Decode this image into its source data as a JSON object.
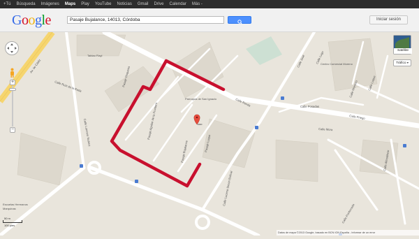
{
  "topnav": {
    "items": [
      "+Tú",
      "Búsqueda",
      "Imágenes",
      "Maps",
      "Play",
      "YouTube",
      "Noticias",
      "Gmail",
      "Drive",
      "Calendar",
      "Más -"
    ],
    "active": "Maps"
  },
  "header": {
    "logo": "Google",
    "search_value": "Pasaje Bujalance, 14013, Córdoba",
    "signin_label": "Iniciar sesión"
  },
  "map": {
    "layer_satellite": "Satélite",
    "layer_traffic": "Tráfico",
    "scale_meters": "50 m",
    "scale_feet": "100 pies",
    "copyright": "Datos de mapa ©2013 Google, basado en BCN IGN España - Informar de un error",
    "places": {
      "tablao": "Tablao Flayl",
      "parroquia": "Parroquia de San Ignacio",
      "centro": "Centro Comercial Moreno",
      "escuela": "Escuelas Hermanos",
      "marquinas": "Marquinas"
    },
    "streets": {
      "av_cadiz": "Av. de Cádiz",
      "calle_ruiz_rada": "Calle Ruiz de la Rada",
      "calle_lorenzo_suarez": "Calle Lorenzo Suárez",
      "pasaje_duquesa": "Pasaje Duquesa",
      "pasaje_aguilar": "Pasaje Aguilar de la Frontera",
      "pasaje_bujalance": "Pasaje Bujalance",
      "pasaje_luque": "Pasaje Luque",
      "calle_ronda": "Calle Ronda",
      "calle_lucena_bolivar": "Calle Lucena Simón Bolívar",
      "calle_jose": "Calle José",
      "calle_lugo": "Calle Lugo",
      "calle_posadas": "Calle Posadas",
      "calle_mora": "Calle Mora",
      "calle_montoro": "Calle Montoro",
      "calle_luque": "Calle Luque",
      "calle_priego": "Calle Priego",
      "calle_almodovar": "Calle Almodóvar",
      "calle_ponferrada": "Calle Ponferrada"
    },
    "route_color": "#c8102e"
  }
}
